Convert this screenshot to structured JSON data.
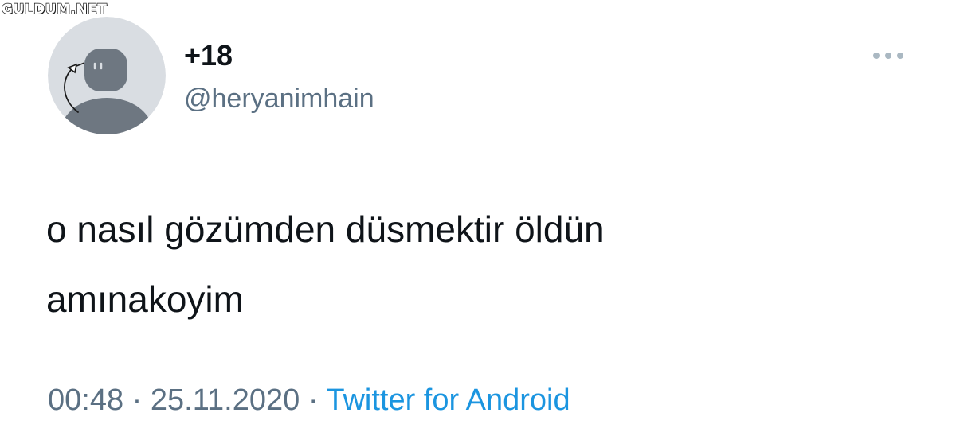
{
  "watermark": "GULDUM.NET",
  "user": {
    "display_name": "+18",
    "handle": "@heryanimhain"
  },
  "tweet": {
    "text_line1": "o nasıl gözümden düsmektir öldün",
    "text_line2": "amınakoyim"
  },
  "meta": {
    "time": "00:48",
    "separator": "·",
    "date": "25.11.2020",
    "source": "Twitter for Android"
  },
  "icons": {
    "more": "more-options-icon",
    "avatar": "default-avatar-icon"
  },
  "colors": {
    "text": "#0f1419",
    "secondary": "#5b7083",
    "link": "#1b95e0",
    "avatar_bg": "#d9dde2",
    "avatar_figure": "#6e7781"
  }
}
